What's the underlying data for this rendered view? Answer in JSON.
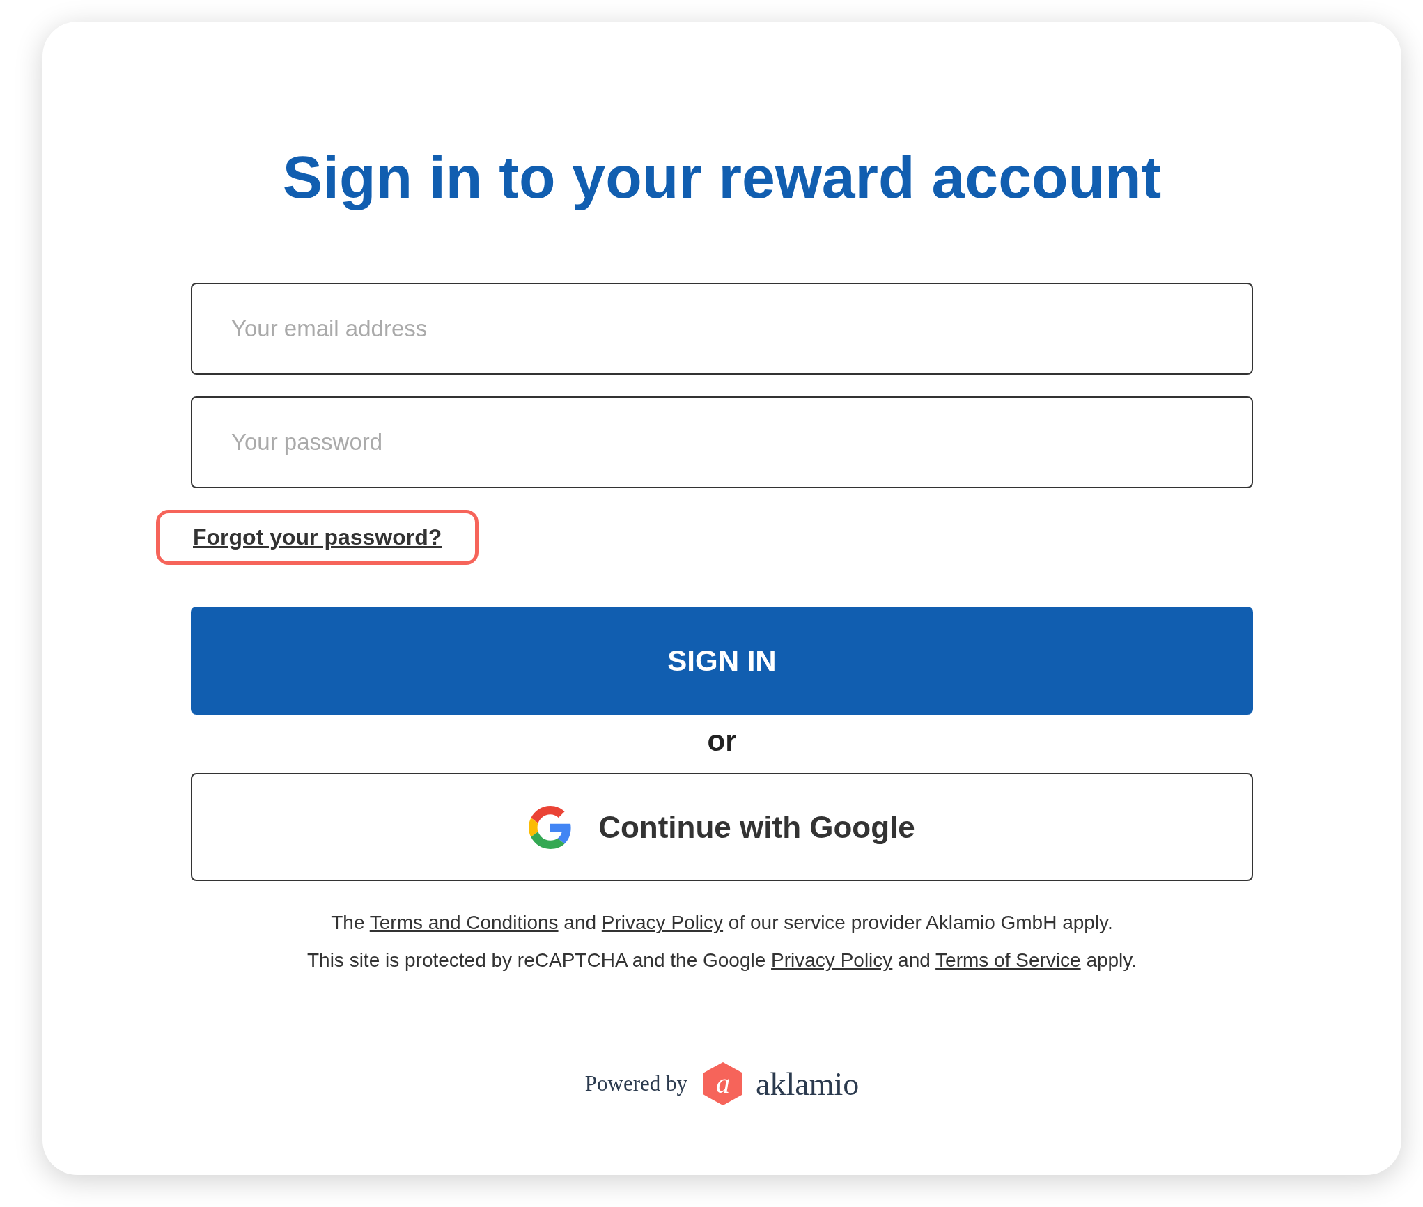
{
  "title": "Sign in to your reward account",
  "fields": [
    {
      "placeholder": "Your email address"
    },
    {
      "placeholder": "Your password"
    }
  ],
  "forgot_link": {
    "label": "Forgot your password?",
    "highlighted": true
  },
  "sign_in_button": "SIGN IN",
  "separator": "or",
  "google_button": "Continue with Google",
  "legal": [
    "The **Terms and Conditions** and **Privacy Policy** of our service provider Aklamio GmbH apply.",
    "This site is protected by reCAPTCHA and the Google **Privacy Policy** and **Terms of Service** apply."
  ],
  "footer": {
    "powered_by": "Powered by",
    "logo_mark": "a",
    "brand": "aklamio"
  }
}
